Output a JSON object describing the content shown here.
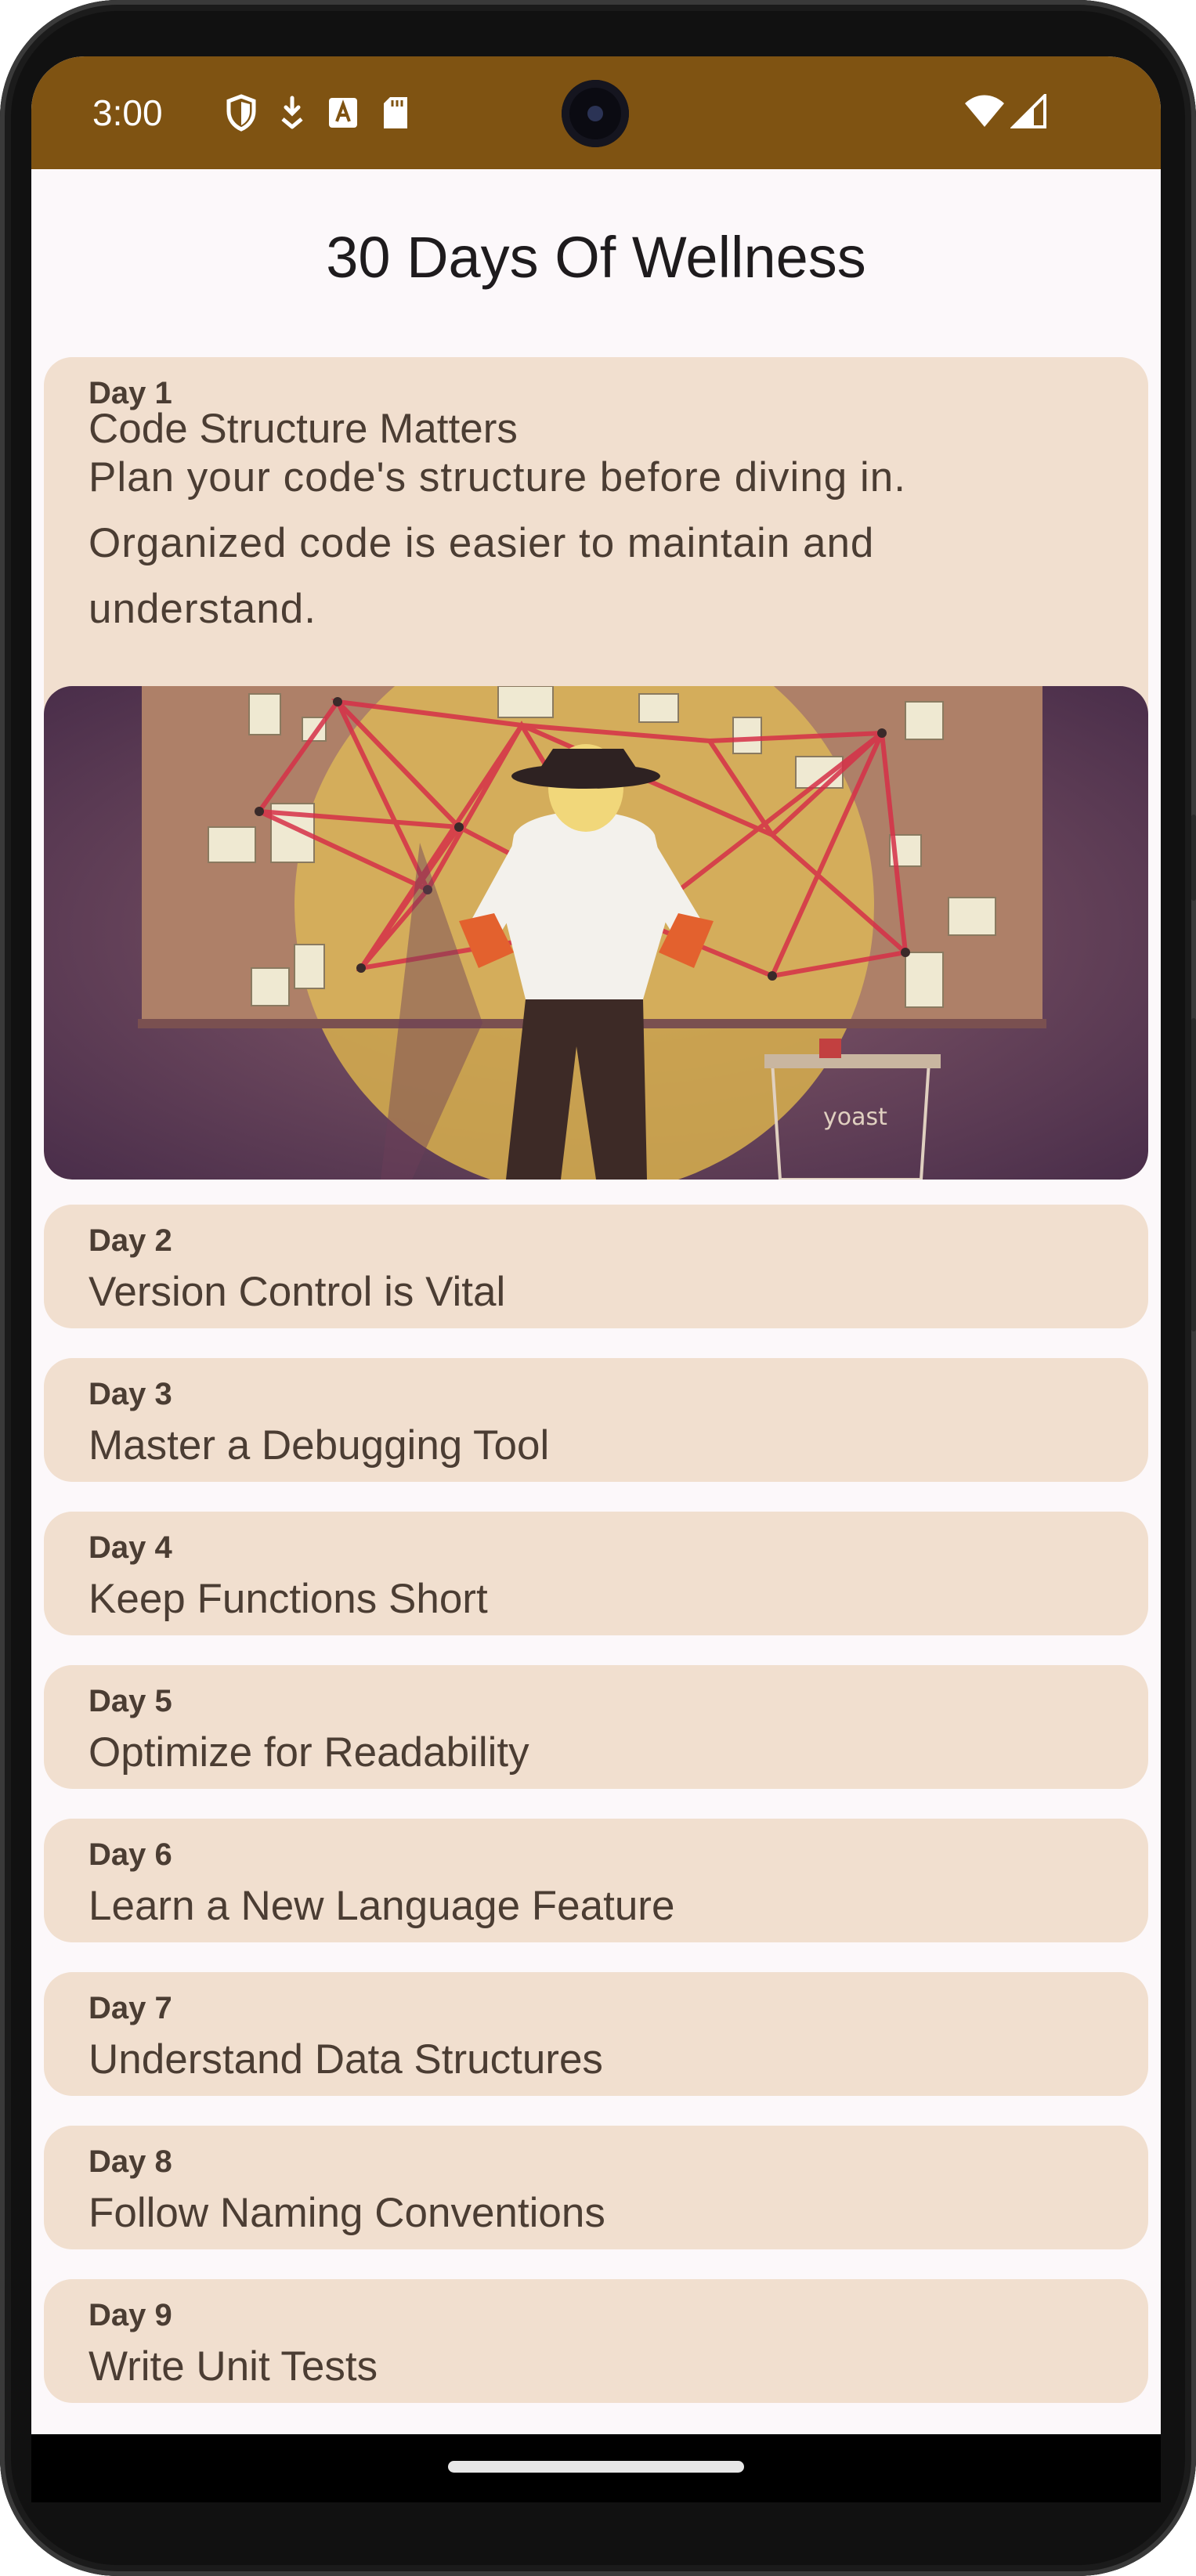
{
  "status_bar": {
    "time": "3:00",
    "left_icons": [
      "shield-icon",
      "download-icon",
      "keyboard-a-icon",
      "sd-card-icon"
    ],
    "right_icons": [
      "wifi-icon",
      "cell-signal-icon"
    ],
    "background": "#7f5312"
  },
  "app": {
    "title": "30 Days Of Wellness",
    "card_color": "#f1dfcf",
    "text_color": "#4b3d33"
  },
  "days": [
    {
      "day": "Day 1",
      "title": "Code Structure Matters",
      "description": "Plan your code's structure before diving in. Organized code is easier to maintain and understand.",
      "expanded": true,
      "image_logo": "yoast"
    },
    {
      "day": "Day 2",
      "title": "Version Control is Vital"
    },
    {
      "day": "Day 3",
      "title": "Master a Debugging Tool"
    },
    {
      "day": "Day 4",
      "title": "Keep Functions Short"
    },
    {
      "day": "Day 5",
      "title": "Optimize for Readability"
    },
    {
      "day": "Day 6",
      "title": "Learn a New Language Feature"
    },
    {
      "day": "Day 7",
      "title": "Understand Data Structures"
    },
    {
      "day": "Day 8",
      "title": "Follow Naming Conventions"
    },
    {
      "day": "Day 9",
      "title": "Write Unit Tests"
    }
  ]
}
